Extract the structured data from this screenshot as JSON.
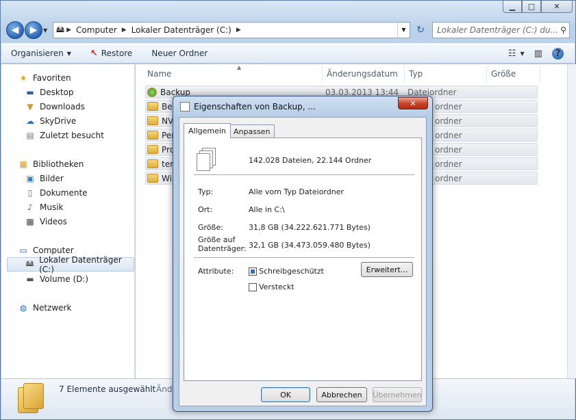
{
  "window": {
    "caption_buttons": {
      "minimize": "▁",
      "maximize": "□",
      "close": "✕"
    }
  },
  "address": {
    "segments": [
      "Computer",
      "Lokaler Datenträger (C:)"
    ],
    "search_placeholder": "Lokaler Datenträger (C:) du..."
  },
  "commandbar": {
    "organize": "Organisieren",
    "restore": "Restore",
    "new_folder": "Neuer Ordner"
  },
  "navpane": {
    "favorites": "Favoriten",
    "desktop": "Desktop",
    "downloads": "Downloads",
    "skydrive": "SkyDrive",
    "recent": "Zuletzt besucht",
    "libraries": "Bibliotheken",
    "pictures": "Bilder",
    "documents": "Dokumente",
    "music": "Musik",
    "videos": "Videos",
    "computer": "Computer",
    "local_disk": "Lokaler Datenträger (C:)",
    "volume_d": "Volume (D:)",
    "network": "Netzwerk"
  },
  "columns": {
    "name": "Name",
    "date": "Änderungsdatum",
    "type": "Typ",
    "size": "Größe"
  },
  "rows": [
    {
      "name": "Backup",
      "date": "03.03.2013 13:44",
      "type": "Dateiordner"
    },
    {
      "name": "Ben",
      "date": "",
      "type": "ordner"
    },
    {
      "name": "NVI",
      "date": "",
      "type": "ordner"
    },
    {
      "name": "Per",
      "date": "",
      "type": "ordner"
    },
    {
      "name": "Pro",
      "date": "",
      "type": "ordner"
    },
    {
      "name": "tem",
      "date": "",
      "type": "ordner"
    },
    {
      "name": "Win",
      "date": "",
      "type": "ordner"
    }
  ],
  "details": {
    "selected": "7 Elemente ausgewählt",
    "extra": "Ände"
  },
  "dialog": {
    "title": "Eigenschaften von Backup, ...",
    "tabs": {
      "general": "Allgemein",
      "customize": "Anpassen"
    },
    "summary": "142.028 Dateien, 22.144 Ordner",
    "type_label": "Typ:",
    "type_value": "Alle vom Typ Dateiordner",
    "location_label": "Ort:",
    "location_value": "Alle in C:\\",
    "size_label": "Größe:",
    "size_value": "31,8 GB (34.222.621.771 Bytes)",
    "disk_size_label_1": "Größe auf",
    "disk_size_label_2": "Datenträger:",
    "disk_size_value": "32,1 GB (34.473.059.480 Bytes)",
    "attributes_label": "Attribute:",
    "readonly": "Schreibgeschützt",
    "hidden": "Versteckt",
    "advanced": "Erweitert...",
    "ok": "OK",
    "cancel": "Abbrechen",
    "apply": "Übernehmen"
  }
}
